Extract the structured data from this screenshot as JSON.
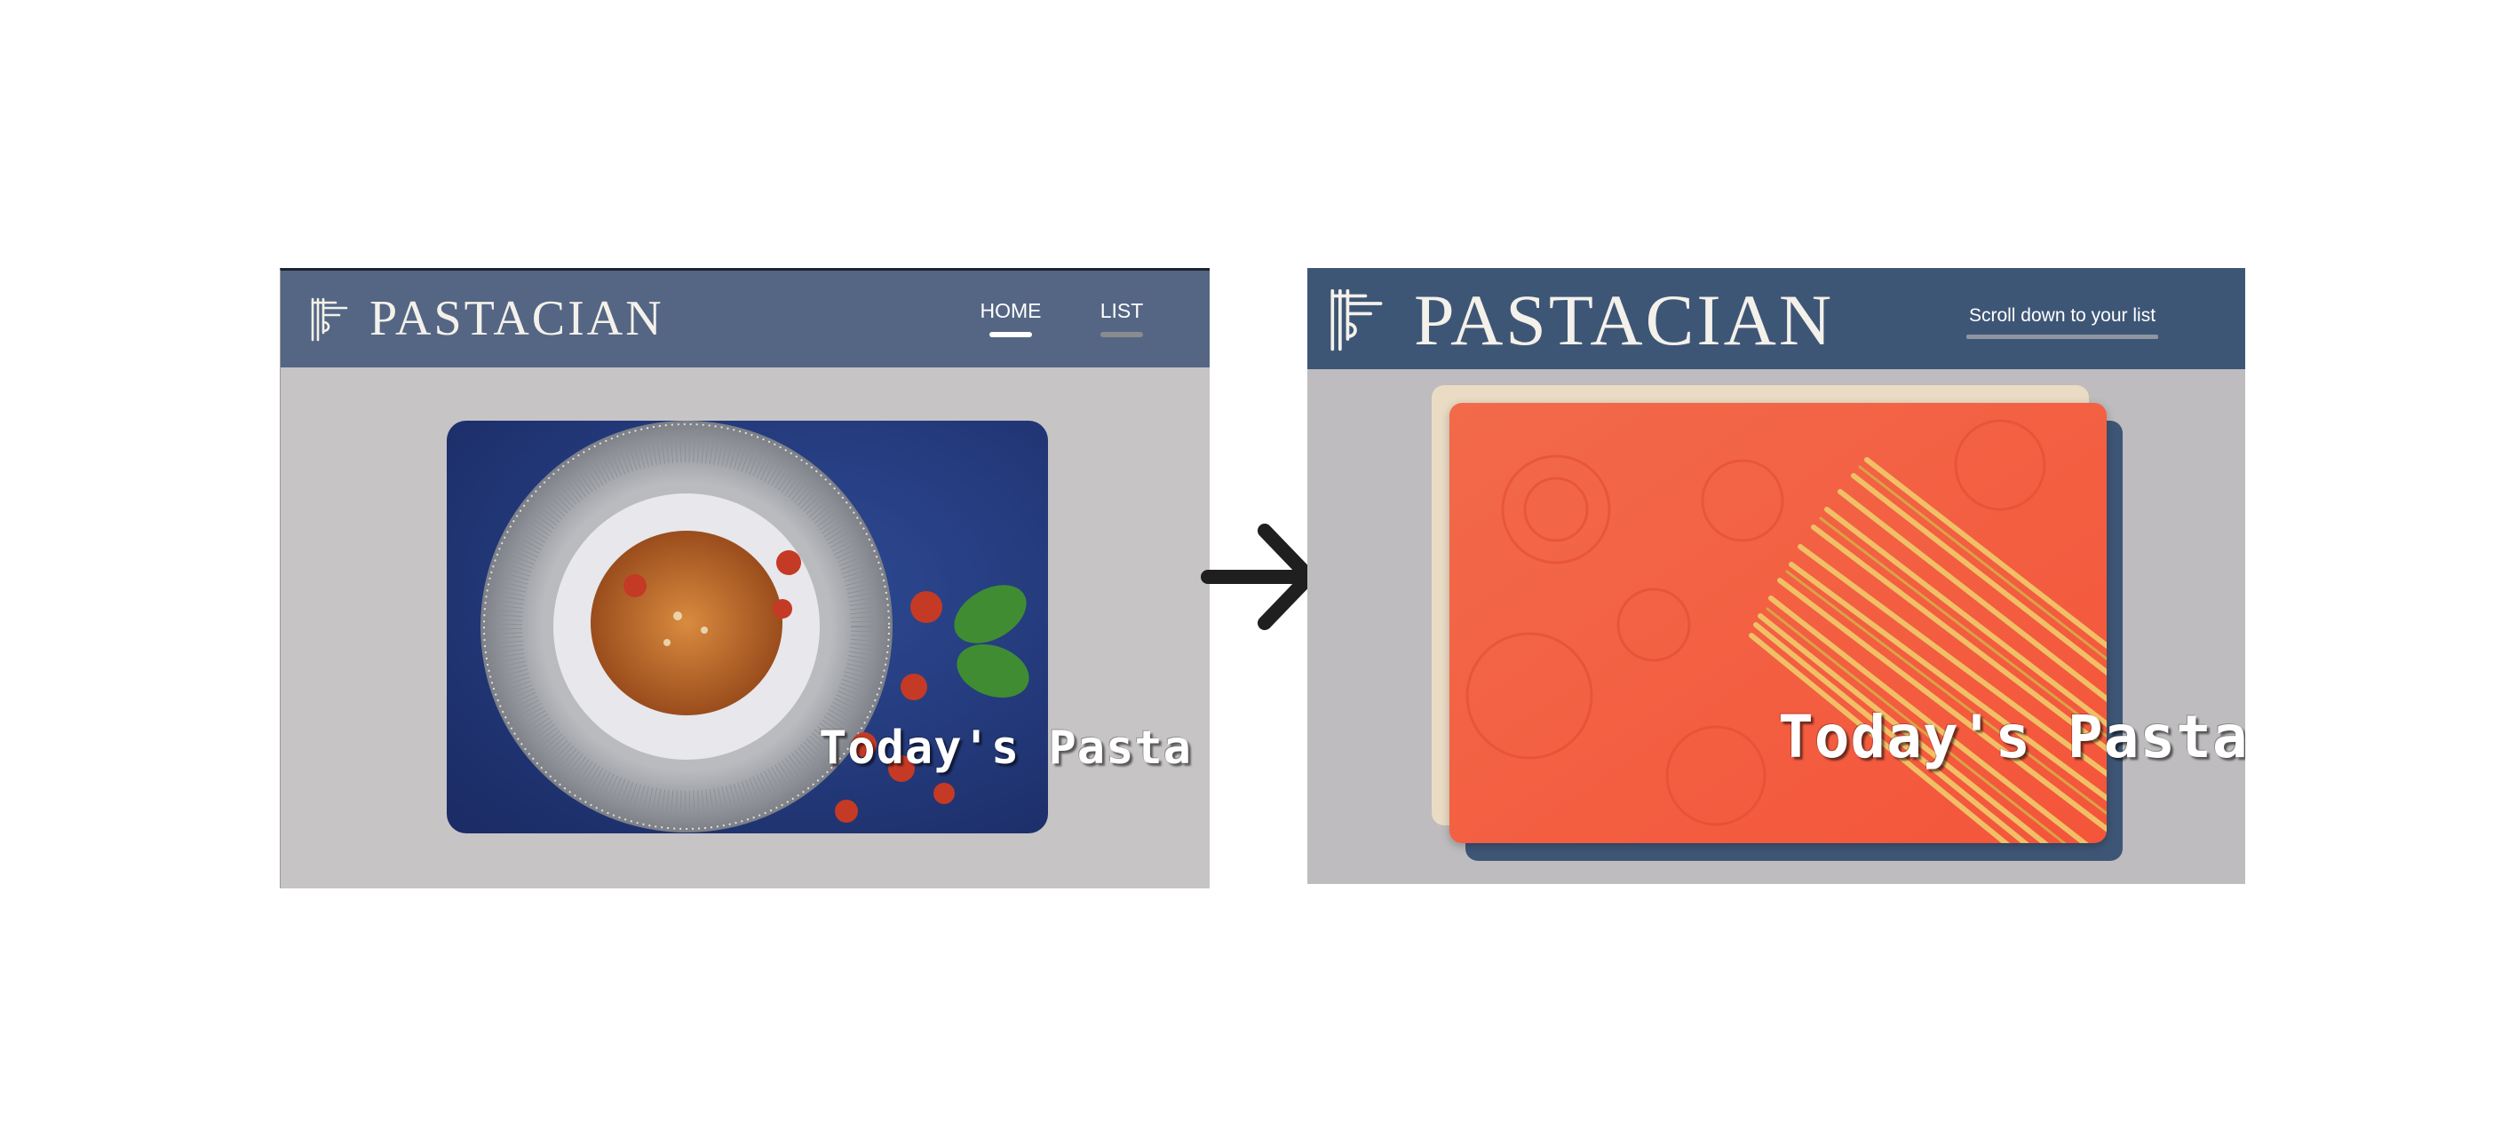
{
  "before": {
    "brand": "PASTACIAN",
    "nav": {
      "home_label": "HOME",
      "list_label": "LIST"
    },
    "card_title": "Today's Pasta"
  },
  "after": {
    "brand": "PASTACIAN",
    "scroll_hint": "Scroll down to your list",
    "card_title": "Today's Pasta"
  },
  "colors": {
    "header_before": "#546684",
    "header_after": "#3e5676",
    "accent_cream": "#eadcc4",
    "accent_coral": "#f2603f"
  },
  "icons": {
    "logo": "fork-pasta-logo-icon",
    "transition": "arrow-right-icon"
  }
}
